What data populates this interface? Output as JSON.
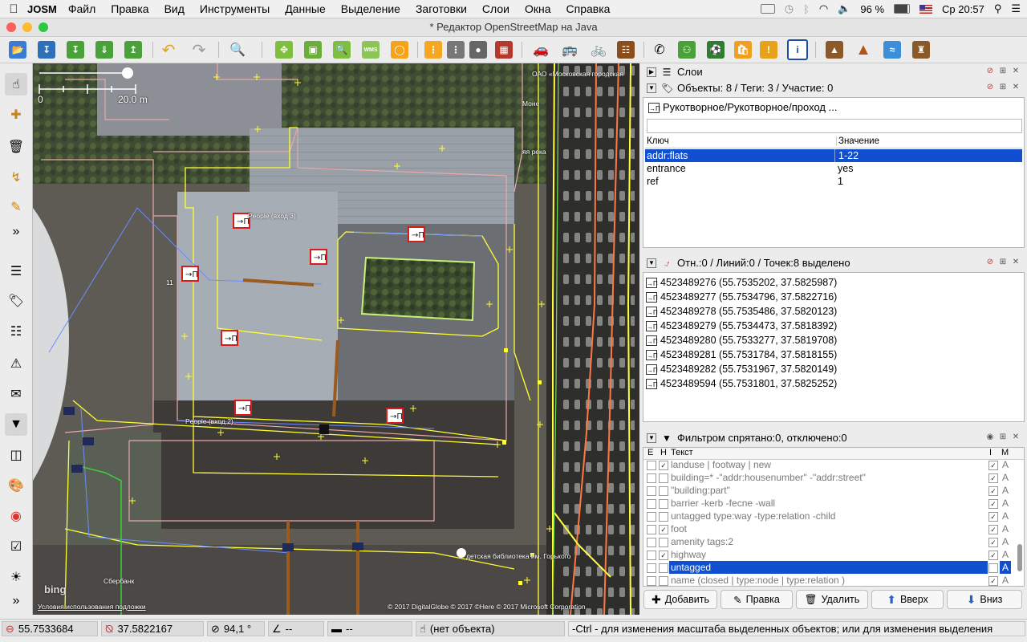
{
  "menubar": {
    "app": "JOSM",
    "items": [
      "Файл",
      "Правка",
      "Вид",
      "Инструменты",
      "Данные",
      "Выделение",
      "Заготовки",
      "Слои",
      "Окна",
      "Справка"
    ],
    "battery": "96 %",
    "clock": "Ср 20:57"
  },
  "window": {
    "title": "* Редактор OpenStreetMap на Java"
  },
  "map": {
    "scale_zero": "0",
    "scale_label": "20.0 m",
    "labels": {
      "people3": "People (вход 3)",
      "people2": "People (вход 2)",
      "oao": "ОАО «Московская городская",
      "mone": "Моне",
      "reka": "яя река",
      "sberbank": "Сбербанк",
      "library": "детская библиотека им. Горького",
      "num11": "11"
    },
    "attribution": "© 2017 DigitalGlobe © 2017 ©Here © 2017 Microsoft Corporation",
    "terms": "Условия использования подложки",
    "bing": "bing"
  },
  "layers_panel": {
    "title": "Слои"
  },
  "tags_panel": {
    "title": "Объекты: 8 / Теги: 3 / Участие: 0",
    "preset": "Рукотворное/Рукотворное/проход ...",
    "col_key": "Ключ",
    "col_value": "Значение",
    "rows": [
      {
        "key": "addr:flats",
        "value": "1-22"
      },
      {
        "key": "entrance",
        "value": "yes"
      },
      {
        "key": "ref",
        "value": "1"
      }
    ]
  },
  "selection_panel": {
    "title": "Отн.:0 / Линий:0 / Точек:8 выделено",
    "items": [
      "4523489276 (55.7535202, 37.5825987)",
      "4523489277 (55.7534796, 37.5822716)",
      "4523489278 (55.7535486, 37.5820123)",
      "4523489279 (55.7534473, 37.5818392)",
      "4523489280 (55.7533277, 37.5819708)",
      "4523489281 (55.7531784, 37.5818155)",
      "4523489282 (55.7531967, 37.5820149)",
      "4523489594 (55.7531801, 37.5825252)"
    ]
  },
  "filter_panel": {
    "title": "Фильтром спрятано:0, отключено:0",
    "col_e": "E",
    "col_h": "H",
    "col_text": "Текст",
    "col_i": "I",
    "col_m": "M",
    "rows": [
      {
        "e": false,
        "h": true,
        "text": "landuse | footway | new",
        "i": true,
        "m": "A",
        "selected": false
      },
      {
        "e": false,
        "h": false,
        "text": "building=* -\"addr:housenumber\" -\"addr:street\"",
        "i": true,
        "m": "A",
        "selected": false
      },
      {
        "e": false,
        "h": false,
        "text": "\"building:part\"",
        "i": true,
        "m": "A",
        "selected": false
      },
      {
        "e": false,
        "h": false,
        "text": "barrier -kerb -fecne -wall",
        "i": true,
        "m": "A",
        "selected": false
      },
      {
        "e": false,
        "h": false,
        "text": "untagged type:way -type:relation  -child",
        "i": true,
        "m": "A",
        "selected": false
      },
      {
        "e": false,
        "h": true,
        "text": "foot",
        "i": true,
        "m": "A",
        "selected": false
      },
      {
        "e": false,
        "h": false,
        "text": "amenity tags:2",
        "i": true,
        "m": "A",
        "selected": false
      },
      {
        "e": false,
        "h": true,
        "text": "highway",
        "i": true,
        "m": "A",
        "selected": false
      },
      {
        "e": false,
        "h": false,
        "text": "untagged",
        "i": false,
        "m": "A",
        "selected": true
      },
      {
        "e": false,
        "h": false,
        "text": "name (closed |  type:node |  type:relation )",
        "i": true,
        "m": "A",
        "selected": false
      }
    ],
    "buttons": {
      "add": "Добавить",
      "edit": "Правка",
      "delete": "Удалить",
      "up": "Вверх",
      "down": "Вниз"
    }
  },
  "statusbar": {
    "lat": "55.7533684",
    "lon": "37.5822167",
    "heading": "94,1 °",
    "angle": "--",
    "distance": "--",
    "object": "(нет объекта)",
    "help": "-Ctrl - для изменения масштаба выделенных объектов; или для изменения выделения"
  },
  "colors": {
    "selection": "#0f4fd0",
    "map_way": "#ffff33",
    "building_outline": "#e8a9a9",
    "road": "#ff7744"
  }
}
